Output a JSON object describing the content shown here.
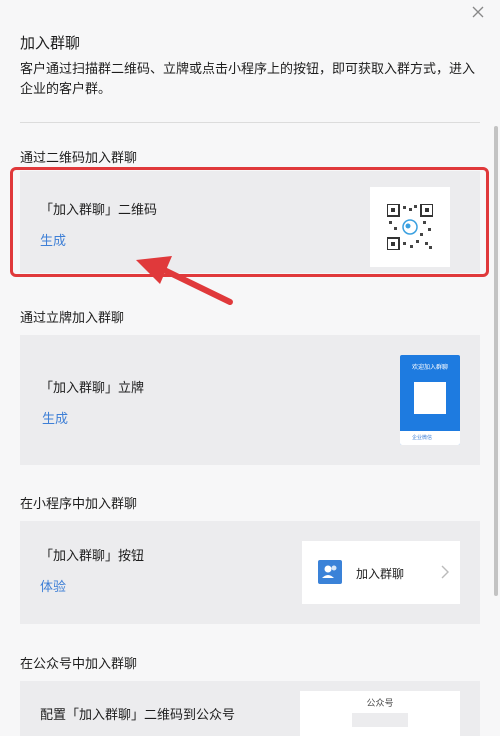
{
  "dialog": {
    "title": "加入群聊",
    "description": "客户通过扫描群二维码、立牌或点击小程序上的按钮，即可获取入群方式，进入企业的客户群。",
    "close_icon": "close-icon"
  },
  "sections": [
    {
      "label": "通过二维码加入群聊",
      "card_title": "「加入群聊」二维码",
      "action": "生成",
      "preview": "qr-code"
    },
    {
      "label": "通过立牌加入群聊",
      "card_title": "「加入群聊」立牌",
      "action": "生成",
      "preview": "stand",
      "stand_title": "欢迎加入群聊",
      "stand_footer": "企业微信"
    },
    {
      "label": "在小程序中加入群聊",
      "card_title": "「加入群聊」按钮",
      "action": "体验",
      "preview": "mini-program-button",
      "button_label": "加入群聊"
    },
    {
      "label": "在公众号中加入群聊",
      "card_title": "配置「加入群聊」二维码到公众号",
      "preview": "official-account",
      "preview_title": "公众号"
    }
  ],
  "colors": {
    "accent": "#3e7fd6",
    "highlight_border": "#e0393b",
    "stand_blue": "#1e7be0",
    "card_bg": "#ececee"
  }
}
